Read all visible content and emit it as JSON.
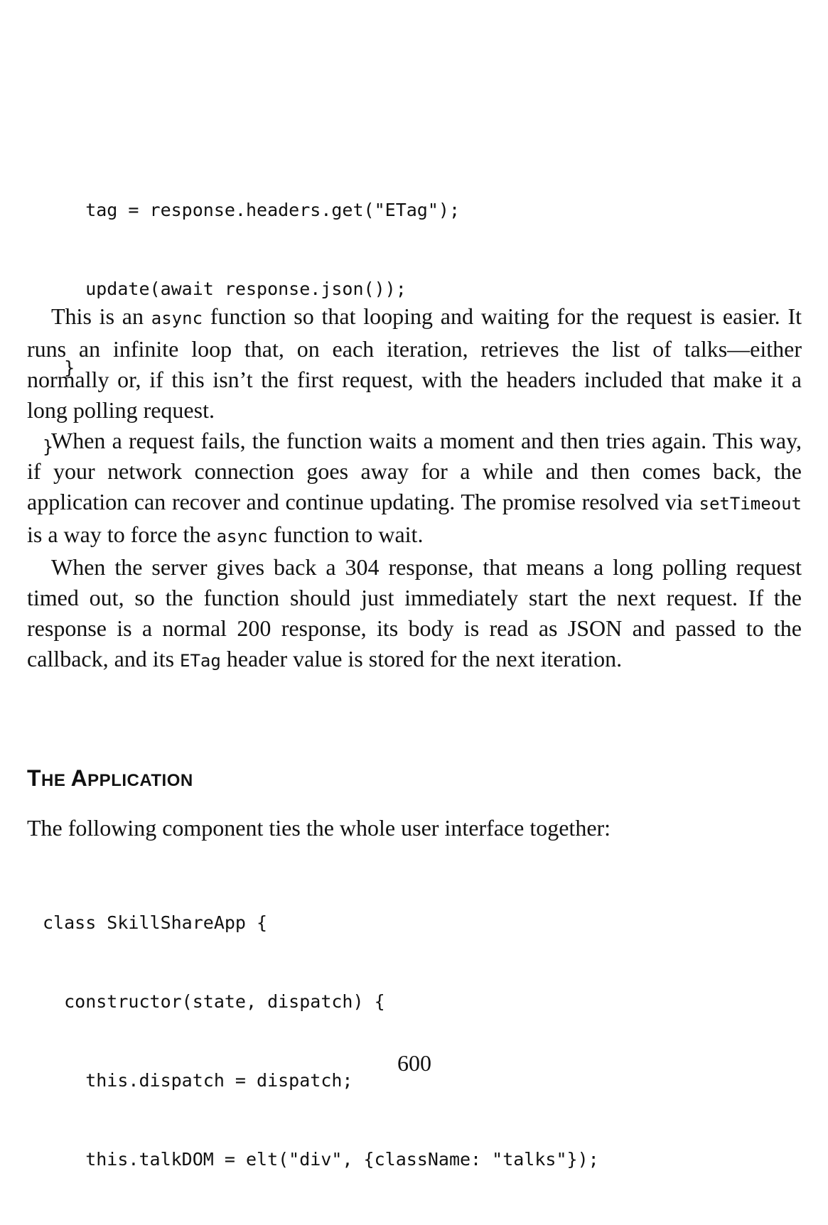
{
  "code_top": {
    "lines": [
      "    tag = response.headers.get(\"ETag\");",
      "    update(await response.json());",
      "  }",
      "}"
    ]
  },
  "paragraphs": {
    "p1": {
      "t1": "This is an ",
      "c1": "async",
      "t2": " function so that looping and waiting for the request is easier. It runs an infinite loop that, on each iteration, retrieves the list of talks—either normally or, if this isn’t the first request, with the headers included that make it a long polling request."
    },
    "p2": {
      "t1": "When a request fails, the function waits a moment and then tries again. This way, if your network connection goes away for a while and then comes back, the application can recover and continue updating. The promise resolved via ",
      "c1": "setTimeout",
      "t2": " is a way to force the ",
      "c2": "async",
      "t3": " function to wait."
    },
    "p3": {
      "t1": "When the server gives back a 304 response, that means a long polling request timed out, so the function should just immediately start the next request. If the response is a normal 200 response, its body is read as JSON and passed to the callback, and its ",
      "c1": "ETag",
      "t2": " header value is stored for the next iteration."
    }
  },
  "section": {
    "heading_cap1": "T",
    "heading_rest1": "HE ",
    "heading_cap2": "A",
    "heading_rest2": "PPLICATION",
    "intro": "The following component ties the whole user interface together:"
  },
  "code_bottom": {
    "lines": [
      "class SkillShareApp {",
      "  constructor(state, dispatch) {",
      "    this.dispatch = dispatch;",
      "    this.talkDOM = elt(\"div\", {className: \"talks\"});"
    ]
  },
  "footer": {
    "page_number": "600"
  }
}
